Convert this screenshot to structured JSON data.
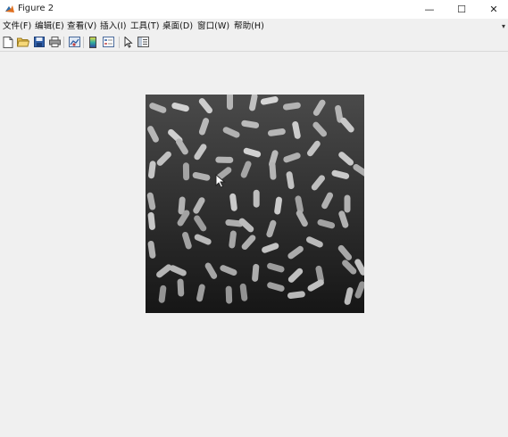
{
  "window": {
    "title": "Figure 2",
    "minimize_glyph": "—",
    "maximize_glyph": "☐",
    "close_glyph": "✕"
  },
  "menu": {
    "items": [
      {
        "label": "文件(F)"
      },
      {
        "label": "编辑(E)"
      },
      {
        "label": "查看(V)"
      },
      {
        "label": "插入(I)"
      },
      {
        "label": "工具(T)"
      },
      {
        "label": "桌面(D)"
      },
      {
        "label": "窗口(W)"
      },
      {
        "label": "帮助(H)"
      }
    ],
    "overflow_glyph": "▾"
  },
  "toolbar": {
    "buttons": [
      {
        "name": "new-figure-icon"
      },
      {
        "name": "open-file-icon"
      },
      {
        "name": "save-icon"
      },
      {
        "name": "print-icon"
      },
      {
        "name": "link-plot-icon"
      },
      {
        "name": "insert-colorbar-icon"
      },
      {
        "name": "insert-legend-icon"
      },
      {
        "name": "edit-plot-pointer-icon"
      },
      {
        "name": "property-inspector-icon"
      }
    ]
  },
  "image": {
    "content": "grayscale image of rice grains on dark background",
    "colormap": "gray"
  },
  "colors": {
    "background": "#f0f0f0",
    "titlebar": "#ffffff",
    "image_bg_top": "#4a4a4a",
    "image_bg_bottom": "#161616",
    "grain": "#c8c8c8"
  }
}
